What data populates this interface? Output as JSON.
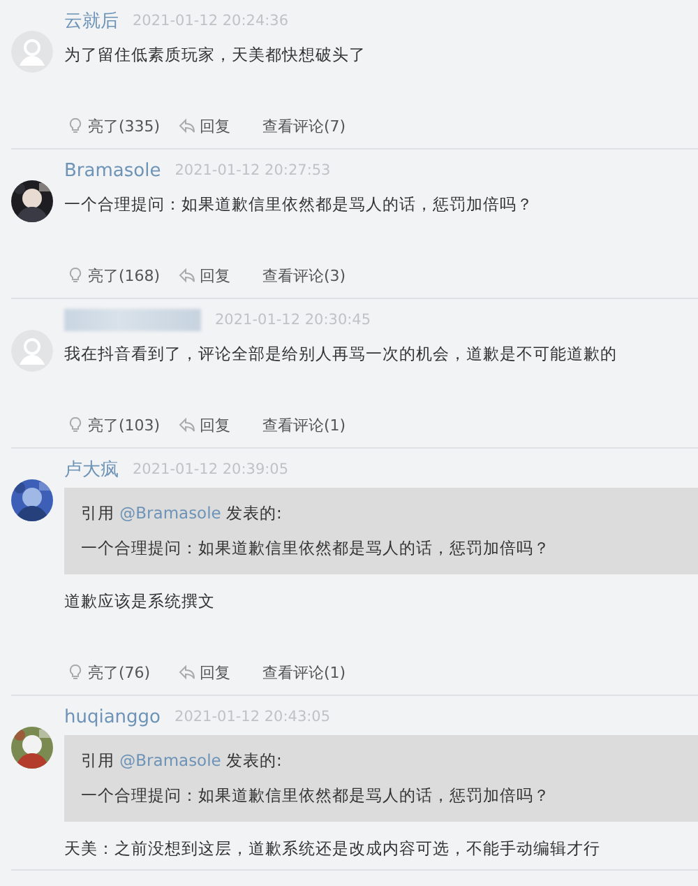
{
  "comments": [
    {
      "avatar": {
        "kind": "default"
      },
      "name": "云就后",
      "name_blurred": false,
      "time": "2021-01-12 20:24:36",
      "body": "为了留住低素质玩家，天美都快想破头了",
      "actions": {
        "like": "亮了(335)",
        "reply": "回复",
        "view": "查看评论(7)"
      }
    },
    {
      "name": "Bramasole",
      "name_blurred": false,
      "time": "2021-01-12 20:27:53",
      "body": "一个合理提问：如果道歉信里依然都是骂人的话，惩罚加倍吗？",
      "actions": {
        "like": "亮了(168)",
        "reply": "回复",
        "view": "查看评论(3)"
      }
    },
    {
      "avatar": {
        "kind": "default"
      },
      "name_blurred": true,
      "time": "2021-01-12 20:30:45",
      "body": "我在抖音看到了，评论全部是给别人再骂一次的机会，道歉是不可能道歉的",
      "actions": {
        "like": "亮了(103)",
        "reply": "回复",
        "view": "查看评论(1)"
      }
    },
    {
      "name": "卢大疯",
      "name_blurred": false,
      "time": "2021-01-12 20:39:05",
      "quote": {
        "prefix": "引用",
        "user": "@Bramasole",
        "suffix": "发表的:",
        "text": "一个合理提问：如果道歉信里依然都是骂人的话，惩罚加倍吗？"
      },
      "body": "道歉应该是系统撰文",
      "actions": {
        "like": "亮了(76)",
        "reply": "回复",
        "view": "查看评论(1)"
      }
    },
    {
      "name": "huqianggo",
      "name_blurred": false,
      "time": "2021-01-12 20:43:05",
      "quote": {
        "prefix": "引用",
        "user": "@Bramasole",
        "suffix": "发表的:",
        "text": "一个合理提问：如果道歉信里依然都是骂人的话，惩罚加倍吗？"
      },
      "body": "天美：之前没想到这层，道歉系统还是改成内容可选，不能手动编辑才行"
    }
  ]
}
